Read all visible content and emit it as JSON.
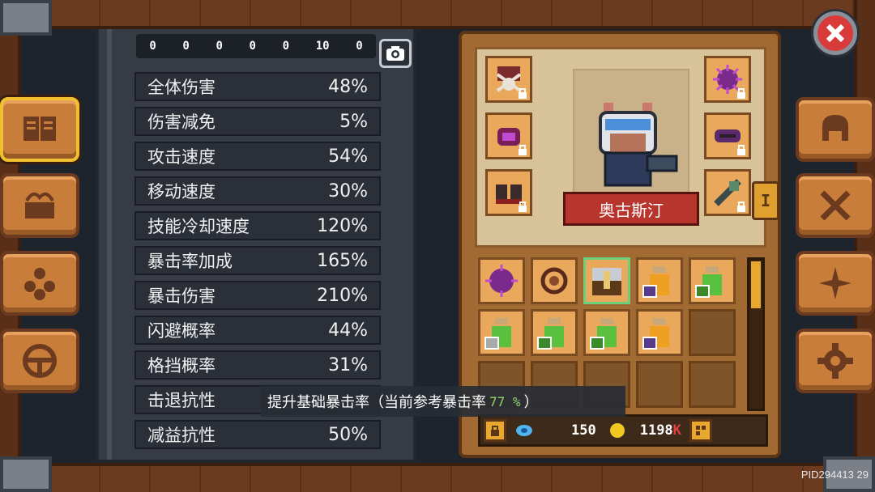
{
  "counter": [
    "0",
    "0",
    "0",
    "0",
    "0",
    "10",
    "0"
  ],
  "stats": [
    {
      "label": "全体伤害",
      "value": "48%"
    },
    {
      "label": "伤害减免",
      "value": "5%"
    },
    {
      "label": "攻击速度",
      "value": "54%"
    },
    {
      "label": "移动速度",
      "value": "30%"
    },
    {
      "label": "技能冷却速度",
      "value": "120%"
    },
    {
      "label": "暴击率加成",
      "value": "165%"
    },
    {
      "label": "暴击伤害",
      "value": "210%"
    },
    {
      "label": "闪避概率",
      "value": "44%"
    },
    {
      "label": "格挡概率",
      "value": "31%"
    },
    {
      "label": "击退抗性",
      "value": ""
    },
    {
      "label": "减益抗性",
      "value": "50%"
    }
  ],
  "tooltip": {
    "text": "提升基础暴击率（当前参考暴击率",
    "value": "77 %",
    "close": "）"
  },
  "character": {
    "name": "奥古斯汀"
  },
  "tab_marker": "I",
  "currency": {
    "gems": "150",
    "gold": "1198",
    "gold_suffix": "K"
  },
  "pid": "PID294413",
  "version": "29",
  "colors": {
    "accent": "#e8a830",
    "crit_highlight": "#8ed66a",
    "banner": "#b8352d"
  }
}
